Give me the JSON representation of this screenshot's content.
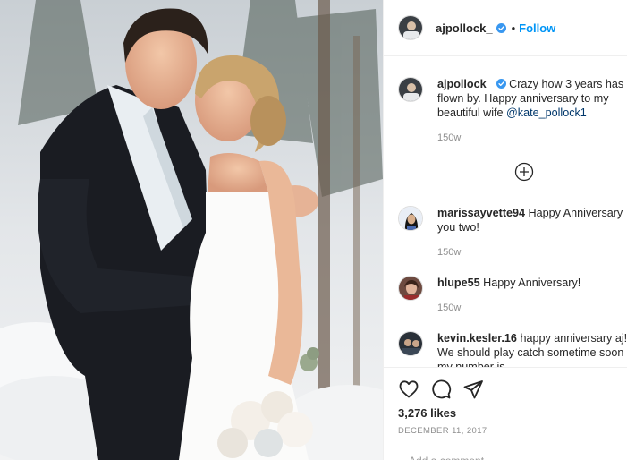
{
  "post": {
    "username": "ajpollock_",
    "follow_label": "Follow",
    "separator": "•",
    "caption": {
      "username": "ajpollock_",
      "text": "Crazy how 3 years has flown by. Happy anniversary to my beautiful wife ",
      "mention": "@kate_pollock1",
      "age": "150w"
    },
    "comments": [
      {
        "username": "marissayvette94",
        "text": "Happy Anniversary you two!",
        "age": "150w"
      },
      {
        "username": "hlupe55",
        "text": "Happy Anniversary!",
        "age": "150w"
      },
      {
        "username": "kevin.kesler.16",
        "text": "happy anniversary aj!!! We should play catch sometime soon my number is",
        "age": ""
      }
    ],
    "likes": "3,276 likes",
    "date": "DECEMBER 11, 2017",
    "add_comment_placeholder": "Add a comment..."
  },
  "colors": {
    "accent": "#0095f6",
    "verified": "#3897f0",
    "muted": "#8e8e8e",
    "mention": "#00376b"
  },
  "icons": [
    "verified-badge-icon",
    "load-more-plus-icon",
    "heart-icon",
    "comment-icon",
    "share-icon",
    "bookmark-icon"
  ]
}
